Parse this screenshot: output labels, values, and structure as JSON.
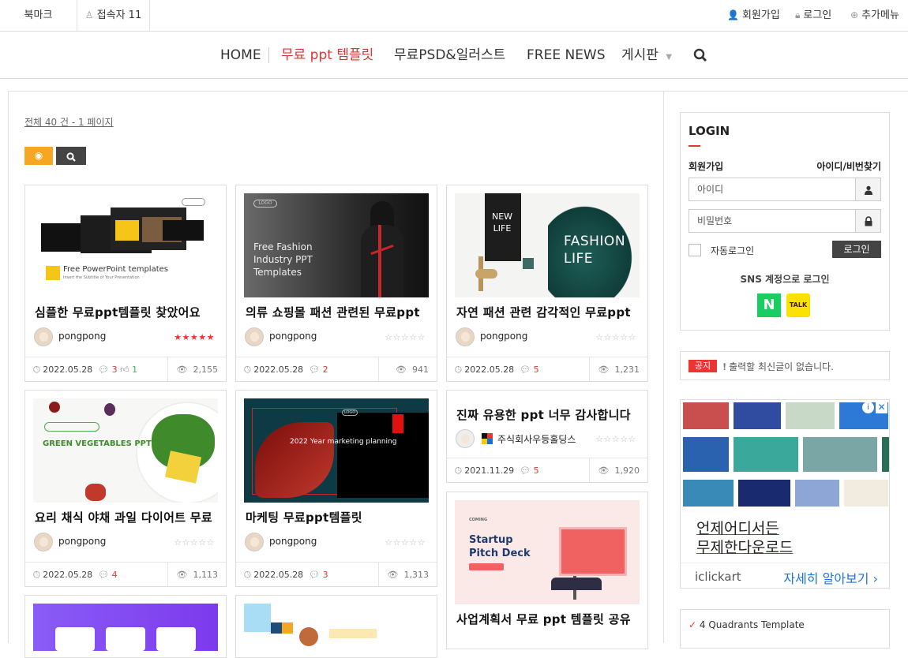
{
  "topbar": {
    "bookmark": "북마크",
    "visitors": "접속자 11",
    "signup": "회원가입",
    "login": "로그인",
    "more_menu": "추가메뉴"
  },
  "nav": {
    "items": [
      "HOME",
      "무료 ppt 템플릿",
      "무료PSD&일러스트",
      "FREE NEWS",
      "게시판"
    ],
    "active_color": "#e03333"
  },
  "list": {
    "count": "전체 40 건 - 1 페이지"
  },
  "cards": [
    {
      "title": "심플한 무료ppt템플릿 찾았어요",
      "thumb_title": "Free PowerPoint templates",
      "thumb_sub": "Insert the Subtitle of Your Presentation",
      "author": "pongpong",
      "rating": 5,
      "date": "2022.05.28",
      "comments": "3",
      "likes": "1",
      "views": "2,155"
    },
    {
      "title": "의류 쇼핑몰 패션 관련된 무료ppt",
      "thumb_title": "Free Fashion Industry PPT Templates",
      "thumb_logo": "LOGO",
      "author": "pongpong",
      "rating": 0,
      "date": "2022.05.28",
      "comments": "2",
      "views": "941"
    },
    {
      "title": "자연 패션 관련 감각적인 무료ppt",
      "thumb_title": "FASHION LIFE",
      "thumb_tag": "NEW LIFE",
      "author": "pongpong",
      "rating": 0,
      "date": "2022.05.28",
      "comments": "5",
      "views": "1,231"
    },
    {
      "title": "요리 채식 야채 과일 다이어트 무료",
      "thumb_title": "GREEN VEGETABLES PPT",
      "author": "pongpong",
      "rating": 0,
      "date": "2022.05.28",
      "comments": "4",
      "views": "1,113"
    },
    {
      "title": "마케팅 무료ppt템플릿",
      "thumb_title": "2022 Year marketing planning",
      "thumb_logo": "LOGO",
      "author": "pongpong",
      "rating": 0,
      "date": "2022.05.28",
      "comments": "3",
      "views": "1,313"
    },
    {
      "title": "진짜 유용한 ppt 너무 감사합니다",
      "author": "주식회사우등홀딩스",
      "rating": 0,
      "date": "2021.11.29",
      "comments": "5",
      "views": "1,920"
    },
    {
      "title": "사업계획서 무료 ppt 템플릿 공유",
      "thumb_title": "Startup Pitch Deck",
      "thumb_tag": "COMING"
    }
  ],
  "sidebar": {
    "login": {
      "heading": "LOGIN",
      "signup": "회원가입",
      "find": "아이디/비번찾기",
      "id_placeholder": "아이디",
      "pw_placeholder": "비밀번호",
      "auto_login": "자동로그인",
      "login_button": "로그인",
      "sns_title": "SNS 계정으로 로그인",
      "naver": "N",
      "kakao": "TALK"
    },
    "notice": {
      "tag": "공지",
      "text": "출력할 최신글이 없습니다."
    },
    "ad": {
      "line1": "언제어디서든",
      "line2": "무제한다운로드",
      "brand": "iclickart",
      "more": "자세히 알아보기"
    },
    "recent": {
      "text": "4 Quadrants Template"
    }
  }
}
